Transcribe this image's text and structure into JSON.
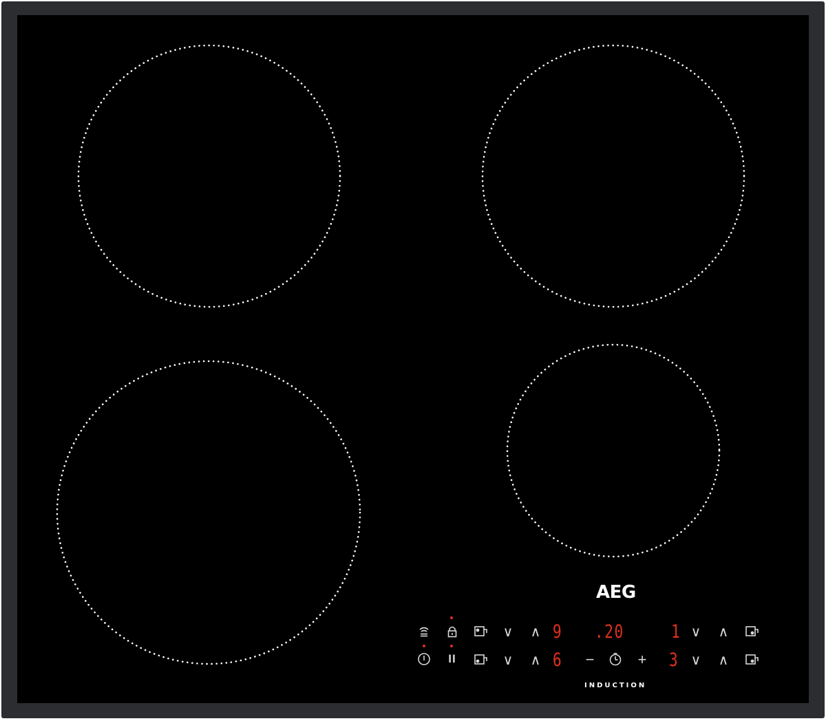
{
  "appliance": {
    "brand": "AEG",
    "type_label": "INDUCTION",
    "frame_color": "#2b2d31",
    "glass_color": "#000000",
    "display_color": "#e0301e"
  },
  "cooking_zones": [
    {
      "name": "rear-left"
    },
    {
      "name": "rear-right"
    },
    {
      "name": "front-left"
    },
    {
      "name": "front-right"
    }
  ],
  "controls": {
    "top_row": {
      "connectivity_icon": "hob-to-hood-icon",
      "lock_icon": "lock-icon",
      "zone_a_icon": "zone-select-icon",
      "zone_a_down": "∨",
      "zone_a_up": "∧",
      "zone_a_level": "9",
      "timer_display": ".20",
      "zone_b_level": "1",
      "zone_b_down": "∨",
      "zone_b_up": "∧",
      "zone_b_icon": "zone-select-icon"
    },
    "bottom_row": {
      "power_icon": "power-icon",
      "pause_label": "II",
      "zone_c_icon": "zone-select-icon",
      "zone_c_down": "∨",
      "zone_c_up": "∧",
      "zone_c_level": "6",
      "timer_minus": "−",
      "timer_icon": "clock-icon",
      "timer_plus": "+",
      "zone_d_level": "3",
      "zone_d_down": "∨",
      "zone_d_up": "∧",
      "zone_d_icon": "zone-select-icon"
    }
  }
}
